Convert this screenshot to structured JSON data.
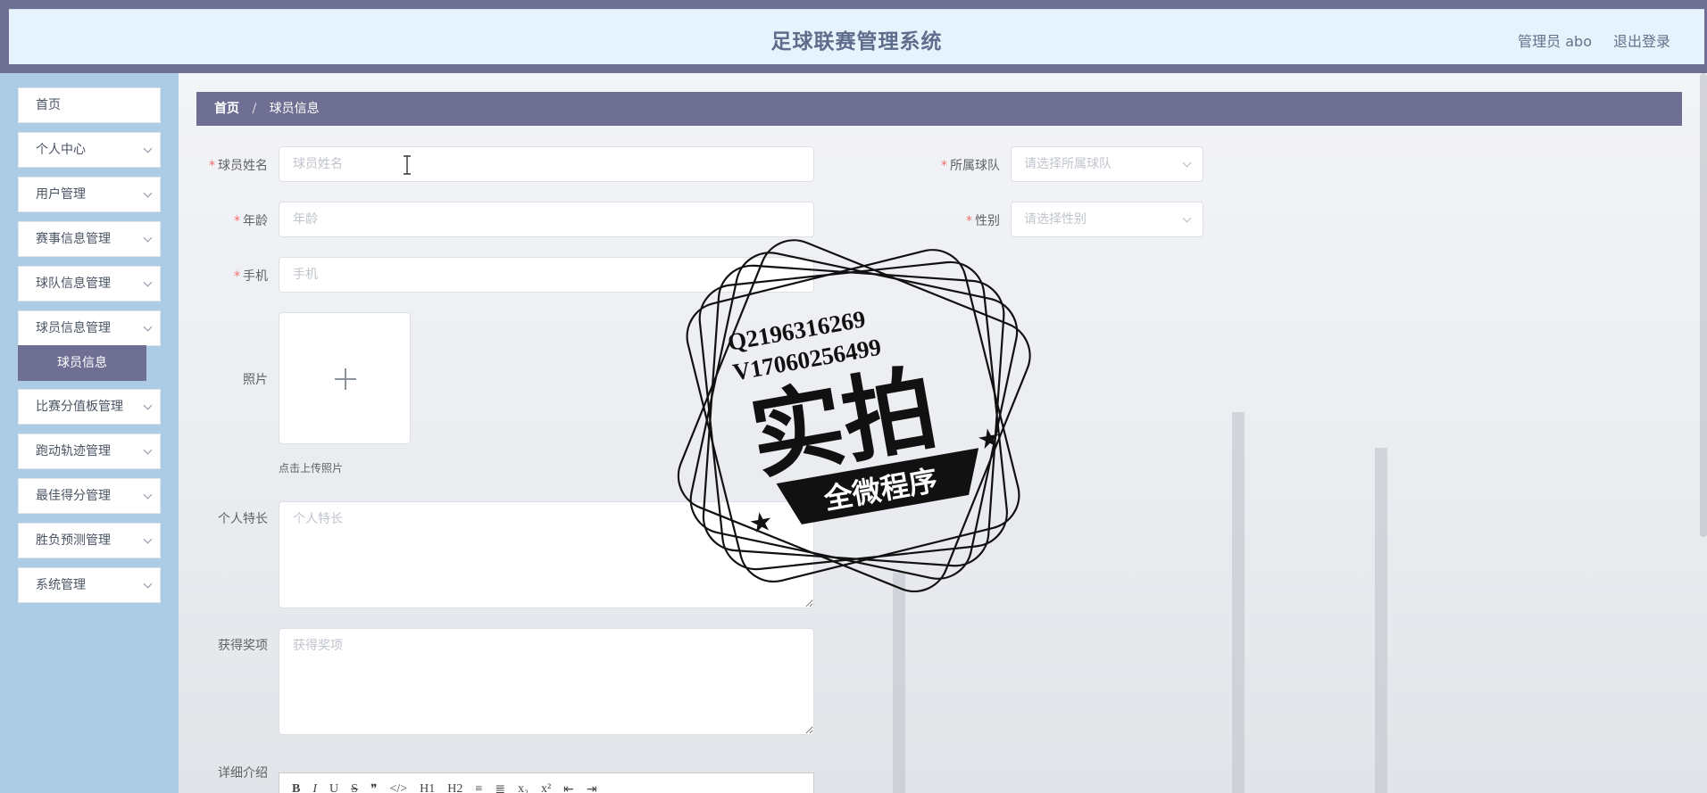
{
  "header": {
    "title": "足球联赛管理系统",
    "user_label": "管理员 abo",
    "logout_label": "退出登录"
  },
  "sidebar": {
    "items": [
      {
        "label": "首页"
      },
      {
        "label": "个人中心"
      },
      {
        "label": "用户管理"
      },
      {
        "label": "赛事信息管理"
      },
      {
        "label": "球队信息管理"
      },
      {
        "label": "球员信息管理"
      },
      {
        "label": "比赛分值板管理"
      },
      {
        "label": "跑动轨迹管理"
      },
      {
        "label": "最佳得分管理"
      },
      {
        "label": "胜负预测管理"
      },
      {
        "label": "系统管理"
      }
    ],
    "active_sub_item": "球员信息"
  },
  "breadcrumb": {
    "home": "首页",
    "separator": "/",
    "current": "球员信息"
  },
  "form": {
    "name": {
      "label": "球员姓名",
      "placeholder": "球员姓名"
    },
    "team": {
      "label": "所属球队",
      "placeholder": "请选择所属球队"
    },
    "age": {
      "label": "年龄",
      "placeholder": "年龄"
    },
    "gender": {
      "label": "性别",
      "placeholder": "请选择性别"
    },
    "phone": {
      "label": "手机",
      "placeholder": "手机"
    },
    "photo": {
      "label": "照片",
      "hint": "点击上传照片"
    },
    "specialty": {
      "label": "个人特长",
      "placeholder": "个人特长"
    },
    "awards": {
      "label": "获得奖项",
      "placeholder": "获得奖项"
    },
    "details": {
      "label": "详细介绍"
    },
    "required_mark": "*"
  },
  "editor_toolbar": [
    "B",
    "I",
    "U",
    "S",
    "❞",
    "</>",
    "H1",
    "H2",
    "≡",
    "≣",
    "x₂",
    "x²",
    "⇤",
    "⇥"
  ],
  "watermark": {
    "line1": "Q2196316269",
    "line2": "V17060256499",
    "main": "实拍",
    "banner": "全微程序"
  }
}
